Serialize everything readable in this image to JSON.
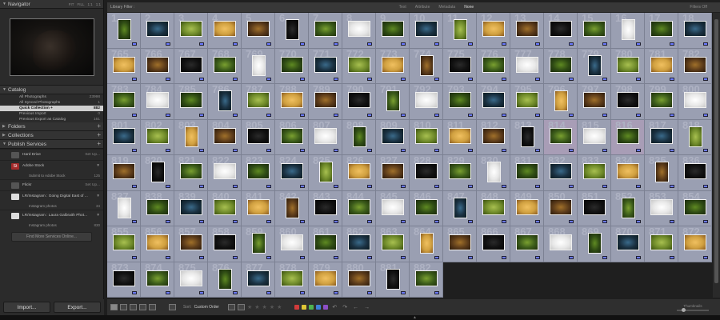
{
  "navigator": {
    "title": "Navigator",
    "opts": [
      "FIT",
      "FILL",
      "1:1",
      "1:1"
    ]
  },
  "catalog": {
    "title": "Catalog",
    "rows": [
      {
        "label": "All Photographs",
        "count": "23998",
        "sel": false
      },
      {
        "label": "All Synced Photographs",
        "count": "1",
        "sel": false
      },
      {
        "label": "Quick Collection +",
        "count": "882",
        "sel": true
      },
      {
        "label": "Previous Import",
        "count": "0",
        "sel": false
      },
      {
        "label": "Previous Export as Catalog",
        "count": "161",
        "sel": false
      }
    ]
  },
  "folders": {
    "title": "Folders"
  },
  "collections": {
    "title": "Collections"
  },
  "publish": {
    "title": "Publish Services",
    "services": [
      {
        "label": "Hard Drive",
        "action": "Set Up...",
        "icon": "hard-drive-icon",
        "sub": null
      },
      {
        "label": "Adobe Stock",
        "action": "▼",
        "icon": "adobe-stock-icon",
        "sub": {
          "label": "Submit to Adobe Stock",
          "count": "125"
        }
      },
      {
        "label": "Flickr",
        "action": "Set Up...",
        "icon": "flickr-icon",
        "sub": null
      },
      {
        "label": "LR/Instagram : Going Digital East of ...",
        "action": "▼",
        "icon": "instagram-icon",
        "sub": {
          "label": "Instagram photos",
          "count": "34"
        }
      },
      {
        "label": "LR/Instagram : Laura Galbraith Phot...",
        "action": "▼",
        "icon": "instagram-icon",
        "sub": {
          "label": "Instagram photos",
          "count": "830"
        }
      }
    ],
    "find_more": "Find More Services Online..."
  },
  "bottom": {
    "import": "Import...",
    "export": "Export..."
  },
  "filter": {
    "title": "Library Filter :",
    "opts": [
      "Text",
      "Attribute",
      "Metadata",
      "None"
    ],
    "active": "None",
    "right": "Filters Off"
  },
  "grid": {
    "row_nums": [
      [
        "1",
        "2",
        "3",
        "4",
        "5",
        "6",
        "7",
        "8",
        "9",
        "10",
        "11",
        "12",
        "13",
        "14",
        "15",
        "16",
        "17",
        "18"
      ],
      [
        "765",
        "766",
        "767",
        "768",
        "769",
        "770",
        "771",
        "772",
        "773",
        "774",
        "775",
        "776",
        "777",
        "778",
        "779",
        "780",
        "781",
        "782"
      ],
      [
        "783",
        "784",
        "785",
        "786",
        "787",
        "788",
        "789",
        "790",
        "791",
        "792",
        "793",
        "794",
        "795",
        "796",
        "797",
        "798",
        "799",
        "800"
      ],
      [
        "801",
        "802",
        "803",
        "804",
        "805",
        "806",
        "807",
        "808",
        "809",
        "810",
        "811",
        "812",
        "813",
        "814",
        "815",
        "816",
        "817",
        "818"
      ],
      [
        "819",
        "820",
        "821",
        "822",
        "823",
        "824",
        "825",
        "826",
        "827",
        "828",
        "829",
        "830",
        "831",
        "832",
        "833",
        "834",
        "835",
        "836"
      ],
      [
        "837",
        "838",
        "839",
        "840",
        "841",
        "842",
        "843",
        "844",
        "845",
        "846",
        "847",
        "848",
        "849",
        "850",
        "851",
        "852",
        "853",
        "854"
      ],
      [
        "855",
        "856",
        "857",
        "858",
        "859",
        "860",
        "861",
        "862",
        "863",
        "864",
        "865",
        "866",
        "867",
        "868",
        "869",
        "870",
        "871",
        "872"
      ],
      [
        "873",
        "874",
        "875",
        "876",
        "877",
        "878",
        "879",
        "880",
        "881",
        "882",
        "",
        "",
        "",
        "",
        "",
        "",
        "",
        ""
      ]
    ]
  },
  "toolbar": {
    "sort_label": "Sort:",
    "sort_value": "Custom Order",
    "thumbs_label": "Thumbnails"
  },
  "colors": {
    "accent_badge": "#6b7aff",
    "cell_bg": "#9a9fb2",
    "selected_cell": "#a89db6",
    "swatches": [
      "#d13b3b",
      "#e0c636",
      "#4fb34f",
      "#3f7fd9",
      "#8d4fc6"
    ]
  }
}
